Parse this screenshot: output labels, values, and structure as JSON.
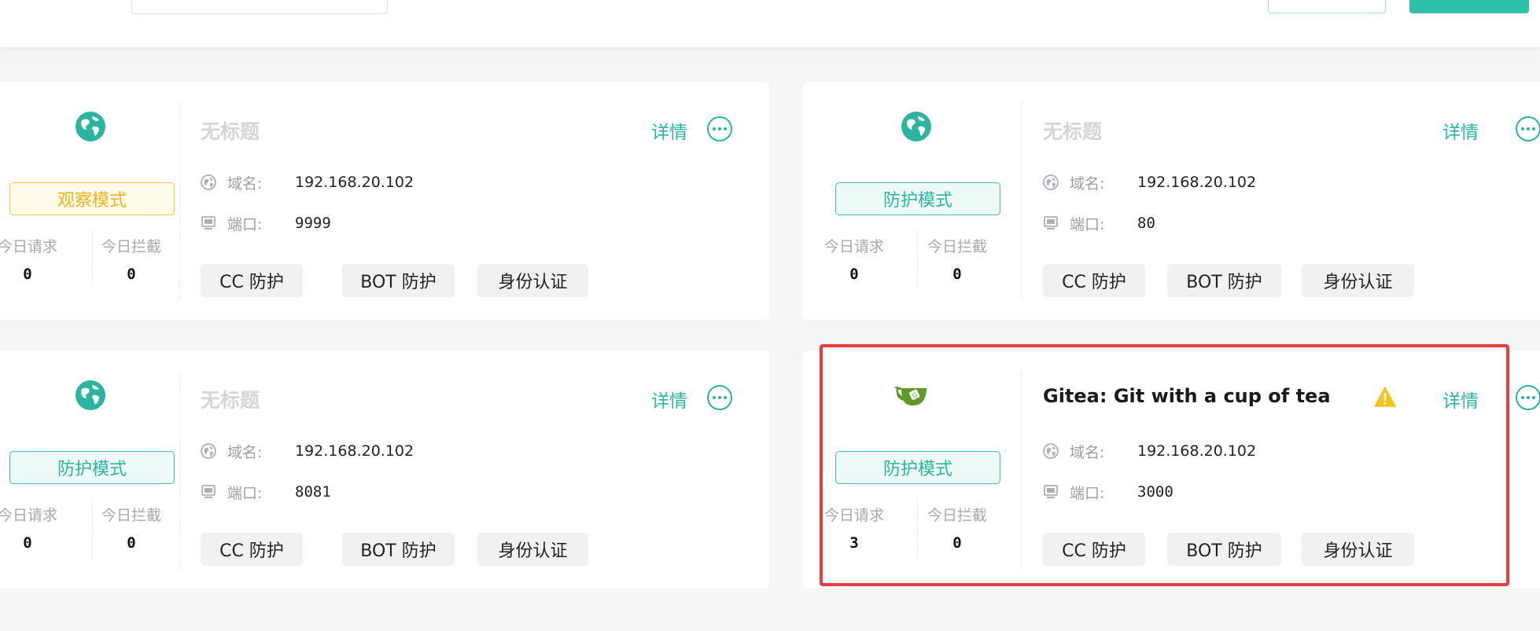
{
  "colors": {
    "accent": "#2bb5a0",
    "observe": "#f1b51c",
    "highlight": "#e93d3d"
  },
  "cards": [
    {
      "icon": "globe-icon",
      "title": "无标题",
      "mode": "观察模式",
      "stats": {
        "requests_label": "今日请求",
        "requests": "0",
        "blocked_label": "今日拦截",
        "blocked": "0"
      },
      "domain_label": "域名:",
      "domain": "192.168.20.102",
      "port_label": "端口:",
      "port": "9999",
      "detail": "详情",
      "tags": [
        "CC 防护",
        "BOT 防护",
        "身份认证"
      ]
    },
    {
      "icon": "globe-icon",
      "title": "无标题",
      "mode": "防护模式",
      "stats": {
        "requests_label": "今日请求",
        "requests": "0",
        "blocked_label": "今日拦截",
        "blocked": "0"
      },
      "domain_label": "域名:",
      "domain": "192.168.20.102",
      "port_label": "端口:",
      "port": "80",
      "detail": "详情",
      "tags": [
        "CC 防护",
        "BOT 防护",
        "身份认证"
      ]
    },
    {
      "icon": "globe-icon",
      "title": "无标题",
      "mode": "防护模式",
      "stats": {
        "requests_label": "今日请求",
        "requests": "0",
        "blocked_label": "今日拦截",
        "blocked": "0"
      },
      "domain_label": "域名:",
      "domain": "192.168.20.102",
      "port_label": "端口:",
      "port": "8081",
      "detail": "详情",
      "tags": [
        "CC 防护",
        "BOT 防护",
        "身份认证"
      ]
    },
    {
      "icon": "gitea-teacup-icon",
      "title": "Gitea: Git with a cup of tea",
      "mode": "防护模式",
      "stats": {
        "requests_label": "今日请求",
        "requests": "3",
        "blocked_label": "今日拦截",
        "blocked": "0"
      },
      "domain_label": "域名:",
      "domain": "192.168.20.102",
      "port_label": "端口:",
      "port": "3000",
      "detail": "详情",
      "warning_icon": "warning-triangle-icon",
      "tags": [
        "CC 防护",
        "BOT 防护",
        "身份认证"
      ]
    }
  ]
}
